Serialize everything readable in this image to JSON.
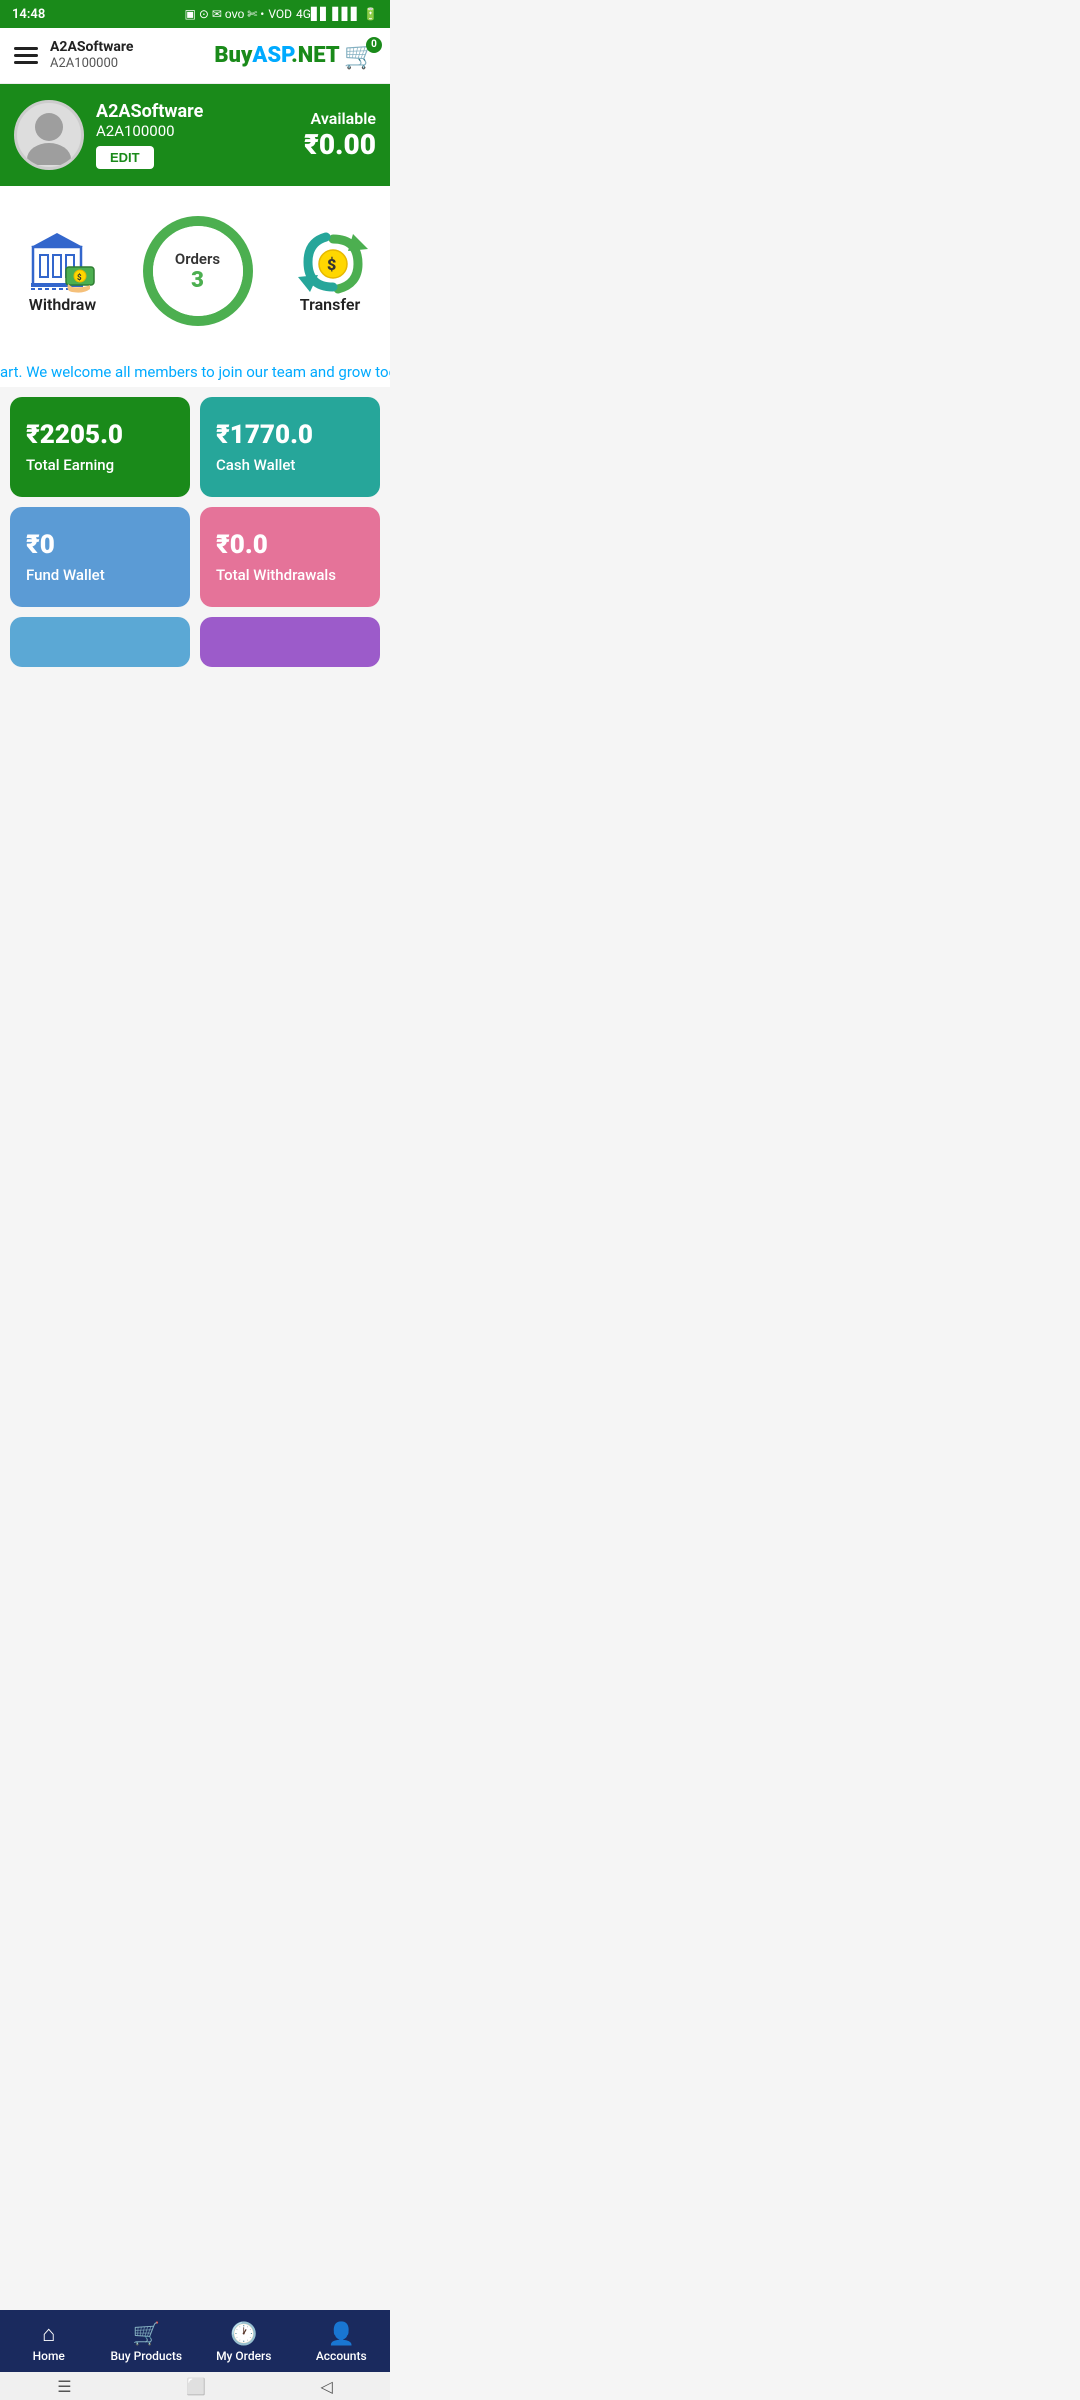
{
  "statusBar": {
    "time": "14:48",
    "rightIcons": "VOD 4G"
  },
  "header": {
    "company": "A2ASoftware",
    "code": "A2A100000",
    "brand": {
      "buy": "Buy",
      "asp": "ASP",
      "net": ".NET"
    },
    "cartCount": "0"
  },
  "profile": {
    "name": "A2ASoftware",
    "code": "A2A100000",
    "editLabel": "EDIT",
    "availableLabel": "Available",
    "amount": "₹0.00"
  },
  "actions": {
    "withdraw": {
      "label": "Withdraw"
    },
    "orders": {
      "label": "Orders",
      "count": "3"
    },
    "transfer": {
      "label": "Transfer"
    }
  },
  "marquee": {
    "text": "art. We welcome all members to join our team and grow together with us. Start earning today!"
  },
  "stats": [
    {
      "amount": "₹2205.0",
      "label": "Total Earning",
      "color": "card-green"
    },
    {
      "amount": "₹1770.0",
      "label": "Cash Wallet",
      "color": "card-teal"
    },
    {
      "amount": "₹0",
      "label": "Fund Wallet",
      "color": "card-blue"
    },
    {
      "amount": "₹0.0",
      "label": "Total Withdrawals",
      "color": "card-pink"
    }
  ],
  "partialCards": [
    {
      "color": "card-lightblue"
    },
    {
      "color": "card-purple"
    }
  ],
  "bottomNav": [
    {
      "id": "home",
      "label": "Home",
      "icon": "⌂"
    },
    {
      "id": "buy-products",
      "label": "Buy Products",
      "icon": "🛒"
    },
    {
      "id": "my-orders",
      "label": "My Orders",
      "icon": "🕐"
    },
    {
      "id": "accounts",
      "label": "Accounts",
      "icon": "👤"
    }
  ]
}
